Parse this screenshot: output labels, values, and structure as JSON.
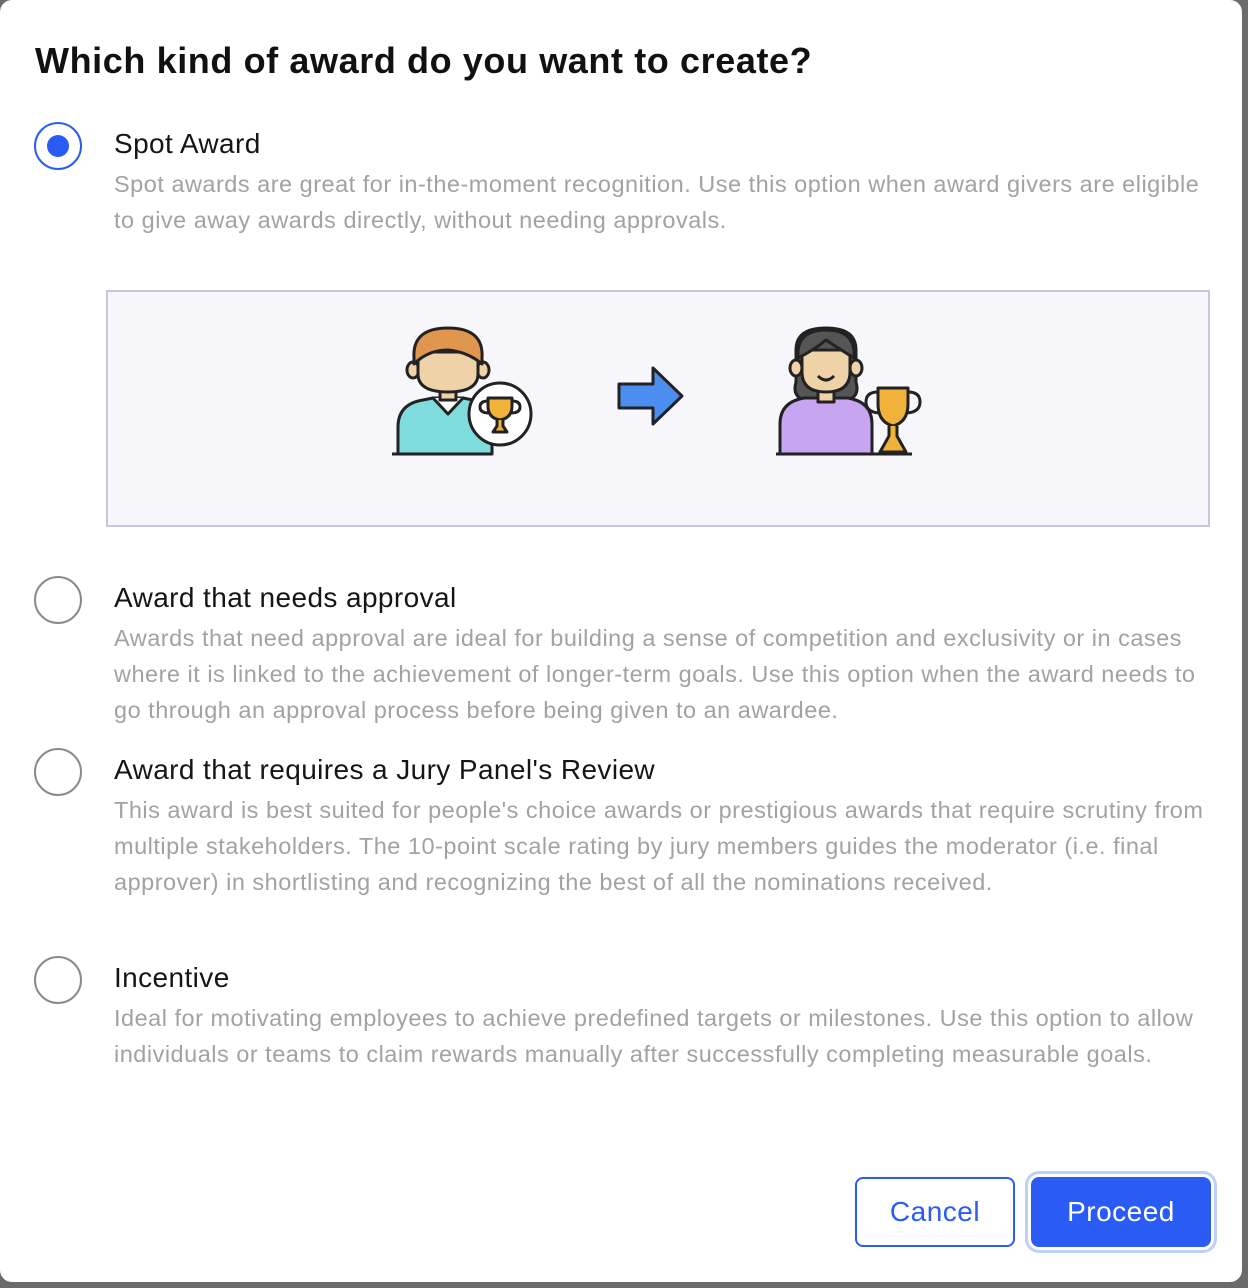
{
  "dialog": {
    "title": "Which kind of award do you want to create?"
  },
  "options": [
    {
      "label": "Spot Award",
      "description": "Spot awards are great for in-the-moment recognition. Use this option when award givers are eligible to give away awards directly, without needing approvals.",
      "selected": true
    },
    {
      "label": "Award that needs approval",
      "description": "Awards that need approval are ideal for building a sense of competition and exclusivity or in cases where it is linked to the achievement of longer-term goals. Use this option when the award needs to go through an approval process before being given to an awardee.",
      "selected": false
    },
    {
      "label": "Award that requires a Jury Panel's Review",
      "description": "This award is best suited for people's choice awards or prestigious awards that require scrutiny from multiple stakeholders. The 10-point scale rating by jury members guides the moderator (i.e. final approver) in shortlisting and recognizing the best of all the nominations received.",
      "selected": false
    },
    {
      "label": "Incentive",
      "description": "Ideal for motivating employees to achieve predefined targets or milestones. Use this option to allow individuals or teams to claim rewards manually after successfully completing measurable goals.",
      "selected": false
    }
  ],
  "illustration": {
    "icons": [
      "award-giver-icon",
      "trophy-badge-icon",
      "arrow-right-icon",
      "awardee-icon",
      "trophy-icon"
    ]
  },
  "buttons": {
    "cancel": "Cancel",
    "proceed": "Proceed"
  },
  "colors": {
    "accent": "#2a5bf5",
    "description_text": "#a2a2a2",
    "illustration_bg": "#f6f6fb"
  }
}
